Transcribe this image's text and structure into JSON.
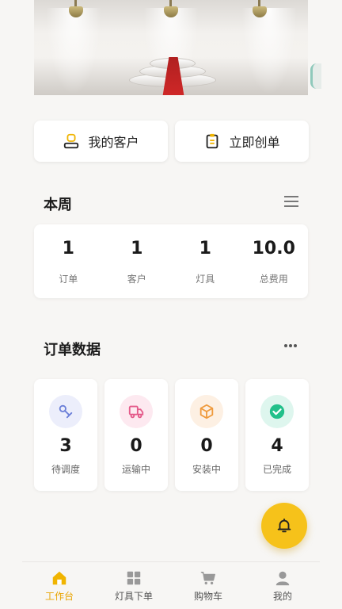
{
  "quick_actions": {
    "my_customers": "我的客户",
    "create_order": "立即创单"
  },
  "week": {
    "title": "本周",
    "stats": [
      {
        "value": "1",
        "label": "订单"
      },
      {
        "value": "1",
        "label": "客户"
      },
      {
        "value": "1",
        "label": "灯具"
      },
      {
        "value": "10.0",
        "label": "总费用"
      }
    ]
  },
  "orders": {
    "title": "订单数据",
    "items": [
      {
        "value": "3",
        "label": "待调度",
        "icon": "dispatch-icon",
        "color": "#6b7fd8"
      },
      {
        "value": "0",
        "label": "运输中",
        "icon": "truck-icon",
        "color": "#e45a8a"
      },
      {
        "value": "0",
        "label": "安装中",
        "icon": "box-icon",
        "color": "#ef9a3c"
      },
      {
        "value": "4",
        "label": "已完成",
        "icon": "check-icon",
        "color": "#22c08a"
      }
    ]
  },
  "tabs": [
    {
      "label": "工作台",
      "icon": "home-icon",
      "active": true
    },
    {
      "label": "灯具下单",
      "icon": "grid-icon"
    },
    {
      "label": "购物车",
      "icon": "cart-icon"
    },
    {
      "label": "我的",
      "icon": "user-icon"
    }
  ],
  "colors": {
    "accent": "#f6c21a",
    "active_tab": "#e8a400"
  }
}
